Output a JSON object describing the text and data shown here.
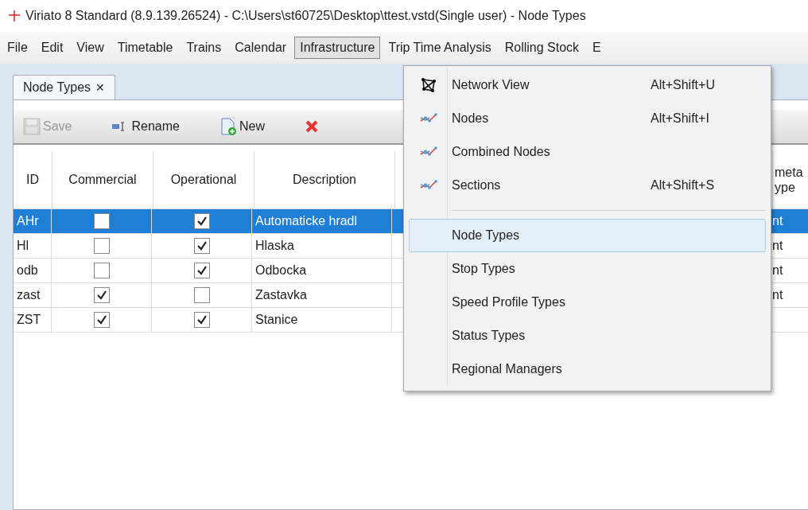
{
  "window": {
    "title": "Viriato 8 Standard (8.9.139.26524) - C:\\Users\\st60725\\Desktop\\ttest.vstd(Single user) -  Node Types"
  },
  "menubar": [
    {
      "label": "File",
      "selected": false
    },
    {
      "label": "Edit",
      "selected": false
    },
    {
      "label": "View",
      "selected": false
    },
    {
      "label": "Timetable",
      "selected": false
    },
    {
      "label": "Trains",
      "selected": false
    },
    {
      "label": "Calendar",
      "selected": false
    },
    {
      "label": "Infrastructure",
      "selected": true
    },
    {
      "label": "Trip Time Analysis",
      "selected": false
    },
    {
      "label": "Rolling Stock",
      "selected": false
    },
    {
      "label": "E",
      "selected": false
    }
  ],
  "tabs": [
    {
      "label": "Node Types",
      "close": "✕"
    }
  ],
  "toolbar": [
    {
      "kind": "save",
      "label": "Save",
      "disabled": true
    },
    {
      "kind": "rename",
      "label": "Rename",
      "disabled": false
    },
    {
      "kind": "new",
      "label": "New",
      "disabled": false
    },
    {
      "kind": "delete",
      "disabled": false
    }
  ],
  "table": {
    "columns": [
      "ID",
      "Commercial",
      "Operational",
      "Description",
      "meta ype"
    ],
    "rows": [
      {
        "id": "AHr",
        "commercial": false,
        "operational": true,
        "description": "Automaticke hradl",
        "column_5": "nt",
        "selected": true
      },
      {
        "id": "Hl",
        "commercial": false,
        "operational": true,
        "description": "Hlaska",
        "column_5": "nt",
        "selected": false
      },
      {
        "id": "odb",
        "commercial": false,
        "operational": true,
        "description": "Odbocka",
        "column_5": "nt",
        "selected": false
      },
      {
        "id": "zast",
        "commercial": true,
        "operational": false,
        "description": "Zastavka",
        "column_5": "nt",
        "selected": false
      },
      {
        "id": "ZST",
        "commercial": true,
        "operational": true,
        "description": "Stanice",
        "selected": false
      }
    ]
  },
  "menu": [
    {
      "kind": "network",
      "label": "Network View",
      "shortcut": "Alt+Shift+U",
      "selected": false
    },
    {
      "kind": "graph",
      "label": "Nodes",
      "shortcut": "Alt+Shift+I",
      "selected": false
    },
    {
      "kind": "graph",
      "label": "Combined Nodes",
      "selected": false
    },
    {
      "kind": "graph",
      "label": "Sections",
      "shortcut": "Alt+Shift+S",
      "selected": false
    },
    {
      "kind": "separator"
    },
    {
      "kind": "plain",
      "label": "Node Types",
      "selected": true
    },
    {
      "kind": "plain",
      "label": "Stop Types",
      "selected": false
    },
    {
      "kind": "plain",
      "label": "Speed Profile Types",
      "selected": false
    },
    {
      "kind": "plain",
      "label": "Status Types",
      "selected": false
    },
    {
      "kind": "plain",
      "label": "Regional Managers",
      "selected": false
    }
  ]
}
